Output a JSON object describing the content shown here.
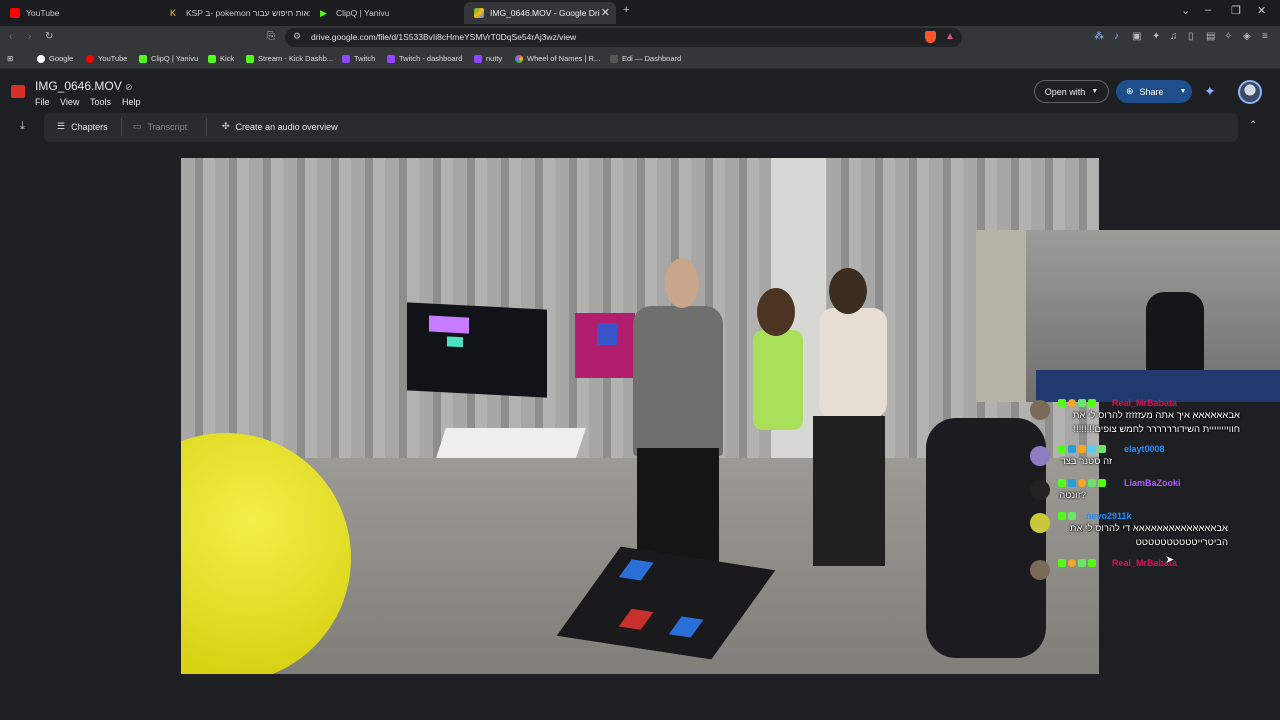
{
  "tabs": [
    {
      "label": "YouTube",
      "favicon_color": "#ff0000"
    },
    {
      "label": "KSP בּ- pokemon תוצאות חיפוש עבור",
      "favicon_color": "#f2c200"
    },
    {
      "label": "ClipQ | Yanivu",
      "favicon_color": "#53fc18"
    },
    {
      "label": "IMG_0646.MOV - Google Dri",
      "favicon_color": "#34a853",
      "active": true
    }
  ],
  "address": {
    "url": "drive.google.com/file/d/1S533BvIi8cHmeYSMVrT0DqSe54rAj3wz/view"
  },
  "bookmarks": [
    {
      "label": "Google",
      "color": "#4285f4"
    },
    {
      "label": "YouTube",
      "color": "#ff0000"
    },
    {
      "label": "ClipQ | Yanivu",
      "color": "#53fc18"
    },
    {
      "label": "Kick",
      "color": "#53fc18"
    },
    {
      "label": "Stream - Kick Dashb...",
      "color": "#53fc18"
    },
    {
      "label": "Twitch",
      "color": "#9146ff"
    },
    {
      "label": "Twitch - dashboard",
      "color": "#9146ff"
    },
    {
      "label": "nutty",
      "color": "#9146ff"
    },
    {
      "label": "Wheel of Names | R...",
      "color": "#e84393"
    },
    {
      "label": "Edi — Dashboard",
      "color": "#888888"
    }
  ],
  "drive": {
    "file_title": "IMG_0646.MOV",
    "menu": [
      "File",
      "View",
      "Tools",
      "Help"
    ],
    "open_with": "Open with",
    "share": "Share"
  },
  "viewer": {
    "chapters": "Chapters",
    "transcript": "Transcript",
    "audio_overview": "Create an audio overview"
  },
  "chat": [
    {
      "name": "Real_MrBabata",
      "name_color": "#d4145a",
      "text": "אבאאאאאא איך אתה מעזזזזז להרוס לי את חוויייייייית השידורררררר לחמש צופים!!!!!!!!",
      "avatar_color": "#7a6a58"
    },
    {
      "name": "elayt0008",
      "name_color": "#1e90ff",
      "text": "זה סטנר בצד",
      "avatar_color": "#8e7cc3"
    },
    {
      "name": "LiamBaZooki",
      "name_color": "#b05cff",
      "text": "?זונטה",
      "avatar_color": "#222222"
    },
    {
      "name": "nevo2911k",
      "name_color": "#1e90ff",
      "text": "אבאאאאאאאאאאאאאא די להרוס לי את הביטרייטטטטטטטטטט",
      "avatar_color": "#c9c93a"
    },
    {
      "name": "Real_MrBabata",
      "name_color": "#d4145a",
      "text": "",
      "avatar_color": "#7a6a58"
    }
  ],
  "colors": {
    "share_bg": "#1e4e8c",
    "accent": "#8ab4f8"
  },
  "icons": [
    "menu-grid-icon",
    "back-icon",
    "forward-icon",
    "reload-icon",
    "bookmark-star-icon",
    "site-info-icon",
    "brave-shield-icon",
    "download-icon",
    "chapters-list-icon",
    "transcript-icon",
    "sparkle-icon",
    "chevron-up-icon",
    "gemini-icon"
  ]
}
